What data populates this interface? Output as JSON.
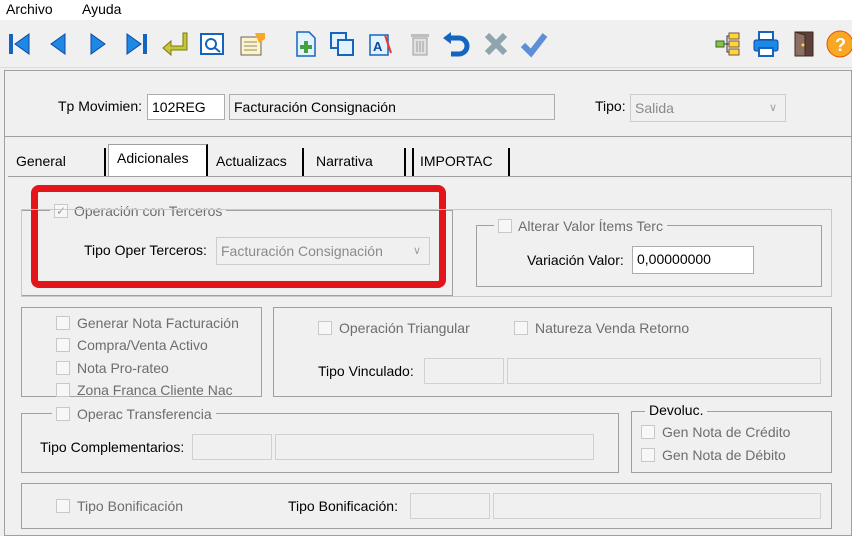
{
  "menu": {
    "archivo": "Archivo",
    "ayuda": "Ayuda"
  },
  "toolbar": {
    "icons": [
      "first-icon",
      "previous-icon",
      "next-icon",
      "last-icon",
      "return-icon",
      "preview-icon",
      "edit-form-icon",
      "new-document-icon",
      "copy-icon",
      "text-format-icon",
      "trash-icon",
      "undo-icon",
      "cancel-icon",
      "confirm-icon",
      "tree-icon",
      "print-icon",
      "exit-door-icon",
      "help-icon"
    ]
  },
  "header": {
    "tp_label": "Tp Movimien:",
    "tp_code": "102REG",
    "tp_desc": "Facturación Consignación",
    "tipo_label": "Tipo:",
    "tipo_value": "Salida"
  },
  "tabs": [
    "General",
    "Adicionales",
    "Actualizacs",
    "Narrativa",
    "IMPORTAC"
  ],
  "adicionales": {
    "op_terceros": {
      "label": "Operación con Terceros",
      "checked": true
    },
    "tipo_oper_label": "Tipo Oper Terceros:",
    "tipo_oper_value": "Facturación Consignación",
    "alterar": {
      "label": "Alterar Valor Ítems Terc",
      "checked": false
    },
    "variacion_label": "Variación Valor:",
    "variacion_value": "0,00000000",
    "checks_left": [
      {
        "label": "Generar Nota Facturación",
        "checked": false
      },
      {
        "label": "Compra/Venta Activo",
        "checked": false
      },
      {
        "label": "Nota Pro-rateo",
        "checked": false
      },
      {
        "label": "Zona Franca Cliente Nac",
        "checked": false
      }
    ],
    "op_triangular": {
      "label": "Operación Triangular",
      "checked": false
    },
    "natureza": {
      "label": "Natureza Venda Retorno",
      "checked": false
    },
    "tipo_vinculado_label": "Tipo Vinculado:",
    "operac_transf": {
      "label": "Operac Transferencia",
      "checked": false
    },
    "tipo_complementarios_label": "Tipo Complementarios:",
    "devoluc": {
      "title": "Devoluc.",
      "credito": {
        "label": "Gen Nota de Crédito",
        "checked": false
      },
      "debito": {
        "label": "Gen Nota de Débito",
        "checked": false
      }
    },
    "tipo_bonificacion_chk": {
      "label": "Tipo Bonificación",
      "checked": false
    },
    "tipo_bonificacion_label": "Tipo Bonificación:"
  },
  "colors": {
    "highlight": "#e3151a",
    "toolbar_blue": "#1565c0"
  }
}
